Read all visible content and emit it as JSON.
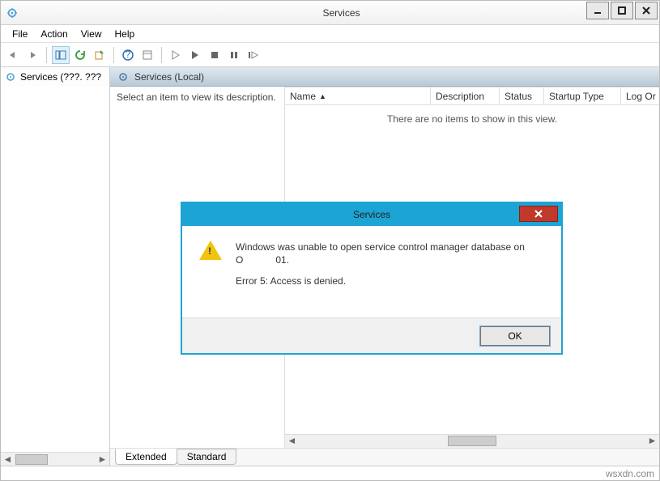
{
  "window": {
    "title": "Services"
  },
  "menu": {
    "file": "File",
    "action": "Action",
    "view": "View",
    "help": "Help"
  },
  "tree": {
    "root_label": "Services (???. ???"
  },
  "header": {
    "title": "Services (Local)"
  },
  "description_hint": "Select an item to view its description.",
  "columns": {
    "name": "Name",
    "description": "Description",
    "status": "Status",
    "startup": "Startup Type",
    "logon": "Log Or"
  },
  "empty_view": "There are no items to show in this view.",
  "tabs": {
    "extended": "Extended",
    "standard": "Standard"
  },
  "statusbar": "wsxdn.com",
  "dialog": {
    "title": "Services",
    "line1": "Windows was unable to open service control manager database on",
    "line2": "O            01.",
    "line3": "Error 5: Access is denied.",
    "ok": "OK"
  }
}
